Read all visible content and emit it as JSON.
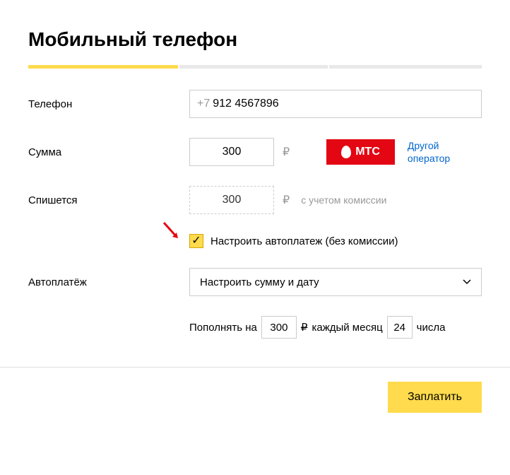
{
  "title": "Мобильный телефон",
  "phone": {
    "label": "Телефон",
    "prefix": "+7",
    "value": "912 4567896"
  },
  "amount": {
    "label": "Сумма",
    "value": "300",
    "currency": "₽",
    "operator_name": "МТС",
    "other_operator_link": "Другой оператор"
  },
  "deducted": {
    "label": "Спишется",
    "value": "300",
    "note": "с учетом комиссии"
  },
  "autopay_checkbox": {
    "label": "Настроить автоплатеж (без комиссии)"
  },
  "autopay": {
    "label": "Автоплатёж",
    "dropdown_text": "Настроить сумму и дату"
  },
  "autopay_settings": {
    "prefix_text": "Пополнять на",
    "amount": "300",
    "middle_text": "каждый месяц",
    "day": "24",
    "suffix_text": "числа"
  },
  "pay_button": "Заплатить"
}
